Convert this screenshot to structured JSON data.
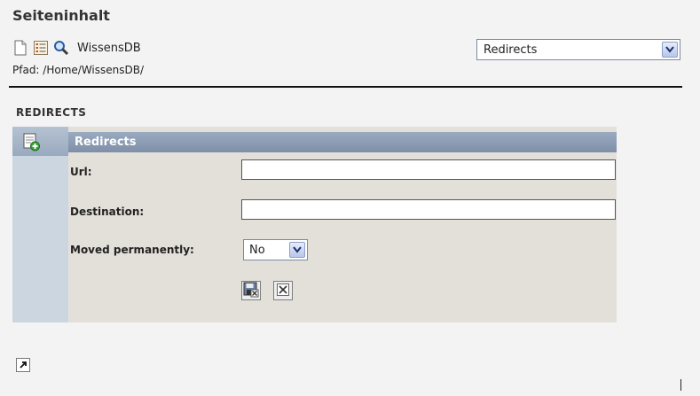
{
  "page": {
    "title": "Seiteninhalt"
  },
  "header": {
    "db_name": "WissensDB",
    "path": "Pfad: /Home/WissensDB/",
    "module_select": "Redirects"
  },
  "section": {
    "title": "REDIRECTS"
  },
  "panel": {
    "heading": "Redirects",
    "fields": {
      "url_label": "Url:",
      "url_value": "",
      "destination_label": "Destination:",
      "destination_value": "",
      "moved_label": "Moved permanently:",
      "moved_value": "No"
    }
  },
  "icons": {
    "new_page": "new-page-icon",
    "list": "list-icon",
    "search": "search-icon",
    "add_record": "add-record-icon",
    "save_close": "save-close-icon",
    "close": "close-icon",
    "link": "shortcut-link-icon"
  }
}
